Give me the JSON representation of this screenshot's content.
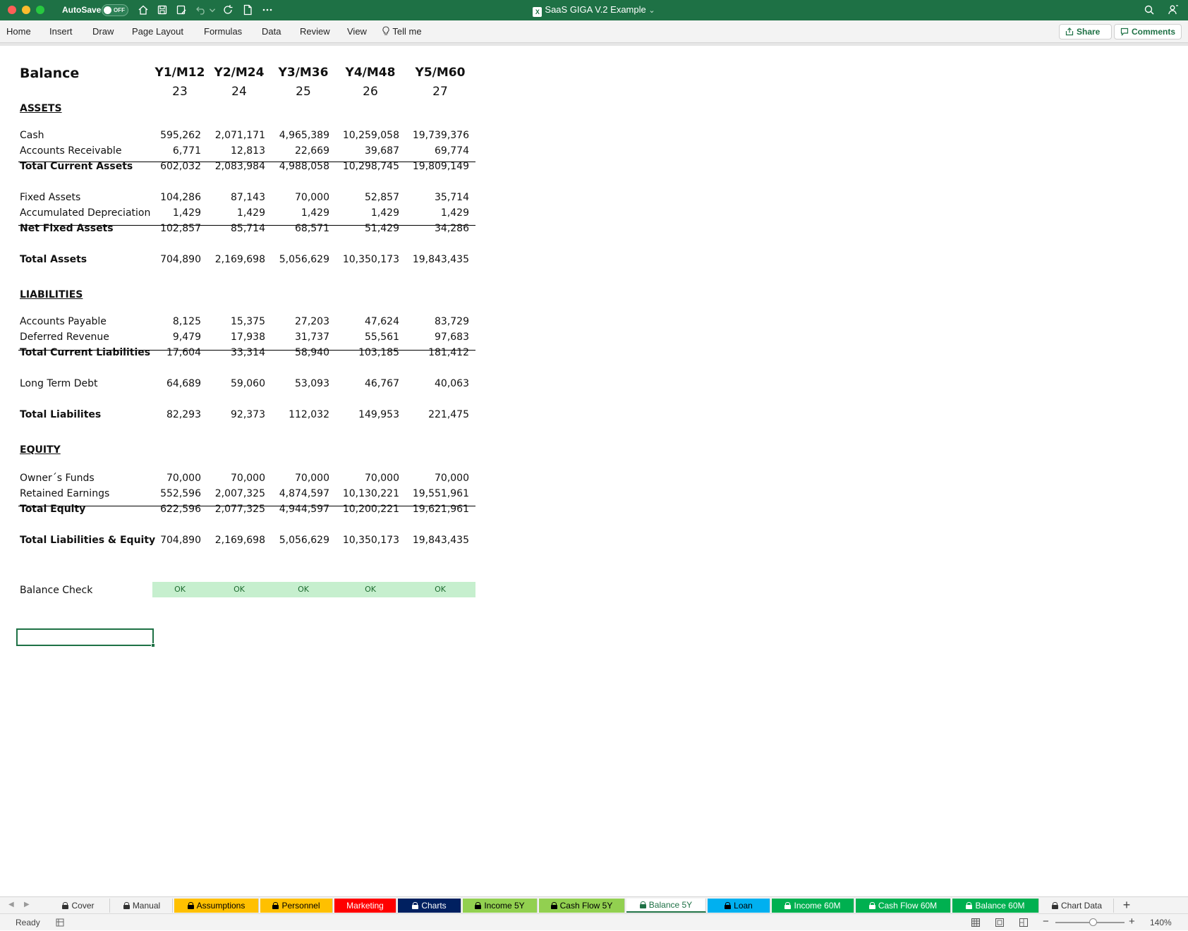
{
  "window": {
    "autosave_label": "AutoSave",
    "autosave_state": "OFF",
    "title": "SaaS GIGA V.2 Example",
    "title_suffix": "⌄"
  },
  "ribbon": {
    "tabs": [
      "Home",
      "Insert",
      "Draw",
      "Page Layout",
      "Formulas",
      "Data",
      "Review",
      "View"
    ],
    "tell_me": "Tell me",
    "share": "Share",
    "comments": "Comments"
  },
  "balance": {
    "title": "Balance",
    "columns": [
      {
        "label": "Y1/M12",
        "num": "23"
      },
      {
        "label": "Y2/M24",
        "num": "24"
      },
      {
        "label": "Y3/M36",
        "num": "25"
      },
      {
        "label": "Y4/M48",
        "num": "26"
      },
      {
        "label": "Y5/M60",
        "num": "27"
      }
    ],
    "sections": {
      "assets": "ASSETS",
      "liabilities": "LIABILITIES",
      "equity": "EQUITY"
    },
    "rows": {
      "cash": {
        "label": "Cash",
        "values": [
          "595,262",
          "2,071,171",
          "4,965,389",
          "10,259,058",
          "19,739,376"
        ]
      },
      "accounts_receivable": {
        "label": "Accounts Receivable",
        "values": [
          "6,771",
          "12,813",
          "22,669",
          "39,687",
          "69,774"
        ]
      },
      "total_current_assets": {
        "label": "Total Current Assets",
        "values": [
          "602,032",
          "2,083,984",
          "4,988,058",
          "10,298,745",
          "19,809,149"
        ]
      },
      "fixed_assets": {
        "label": "Fixed Assets",
        "values": [
          "104,286",
          "87,143",
          "70,000",
          "52,857",
          "35,714"
        ]
      },
      "accumulated_depreciation": {
        "label": "Accumulated Depreciation",
        "values": [
          "1,429",
          "1,429",
          "1,429",
          "1,429",
          "1,429"
        ]
      },
      "net_fixed_assets": {
        "label": "Net Fixed Assets",
        "values": [
          "102,857",
          "85,714",
          "68,571",
          "51,429",
          "34,286"
        ]
      },
      "total_assets": {
        "label": "Total Assets",
        "values": [
          "704,890",
          "2,169,698",
          "5,056,629",
          "10,350,173",
          "19,843,435"
        ]
      },
      "accounts_payable": {
        "label": "Accounts Payable",
        "values": [
          "8,125",
          "15,375",
          "27,203",
          "47,624",
          "83,729"
        ]
      },
      "deferred_revenue": {
        "label": "Deferred Revenue",
        "values": [
          "9,479",
          "17,938",
          "31,737",
          "55,561",
          "97,683"
        ]
      },
      "total_current_liabilities": {
        "label": "Total Current Liabilities",
        "values": [
          "17,604",
          "33,314",
          "58,940",
          "103,185",
          "181,412"
        ]
      },
      "long_term_debt": {
        "label": "Long Term Debt",
        "values": [
          "64,689",
          "59,060",
          "53,093",
          "46,767",
          "40,063"
        ]
      },
      "total_liabilities": {
        "label": "Total Liabilites",
        "values": [
          "82,293",
          "92,373",
          "112,032",
          "149,953",
          "221,475"
        ]
      },
      "owners_funds": {
        "label": "Owner´s Funds",
        "values": [
          "70,000",
          "70,000",
          "70,000",
          "70,000",
          "70,000"
        ]
      },
      "retained_earnings": {
        "label": "Retained Earnings",
        "values": [
          "552,596",
          "2,007,325",
          "4,874,597",
          "10,130,221",
          "19,551,961"
        ]
      },
      "total_equity": {
        "label": "Total Equity",
        "values": [
          "622,596",
          "2,077,325",
          "4,944,597",
          "10,200,221",
          "19,621,961"
        ]
      },
      "total_liabilities_equity": {
        "label": "Total Liabilities & Equity",
        "values": [
          "704,890",
          "2,169,698",
          "5,056,629",
          "10,350,173",
          "19,843,435"
        ]
      }
    },
    "balance_check": {
      "label": "Balance Check",
      "values": [
        "OK",
        "OK",
        "OK",
        "OK",
        "OK"
      ]
    }
  },
  "sheet_tabs": [
    {
      "label": "Cover",
      "bg": "#f3f3f3",
      "fg": "#333333",
      "locked": true
    },
    {
      "label": "Manual",
      "bg": "#f3f3f3",
      "fg": "#333333",
      "locked": true
    },
    {
      "label": "Assumptions",
      "bg": "#ffc000",
      "fg": "#000000",
      "locked": true
    },
    {
      "label": "Personnel",
      "bg": "#ffc000",
      "fg": "#000000",
      "locked": true
    },
    {
      "label": "Marketing",
      "bg": "#ff0000",
      "fg": "#ffffff",
      "locked": false
    },
    {
      "label": "Charts",
      "bg": "#002060",
      "fg": "#ffffff",
      "locked": true
    },
    {
      "label": "Income 5Y",
      "bg": "#92d050",
      "fg": "#000000",
      "locked": true
    },
    {
      "label": "Cash Flow 5Y",
      "bg": "#92d050",
      "fg": "#000000",
      "locked": true
    },
    {
      "label": "Balance 5Y",
      "bg": "#ffffff",
      "fg": "#1e7145",
      "locked": true,
      "active": true
    },
    {
      "label": "Loan",
      "bg": "#00b0f0",
      "fg": "#000000",
      "locked": true
    },
    {
      "label": "Income 60M",
      "bg": "#00b050",
      "fg": "#ffffff",
      "locked": true
    },
    {
      "label": "Cash Flow 60M",
      "bg": "#00b050",
      "fg": "#ffffff",
      "locked": true
    },
    {
      "label": "Balance 60M",
      "bg": "#00b050",
      "fg": "#ffffff",
      "locked": true
    },
    {
      "label": "Chart Data",
      "bg": "#f3f3f3",
      "fg": "#333333",
      "locked": true
    }
  ],
  "status": {
    "ready": "Ready",
    "zoom": "140%"
  }
}
